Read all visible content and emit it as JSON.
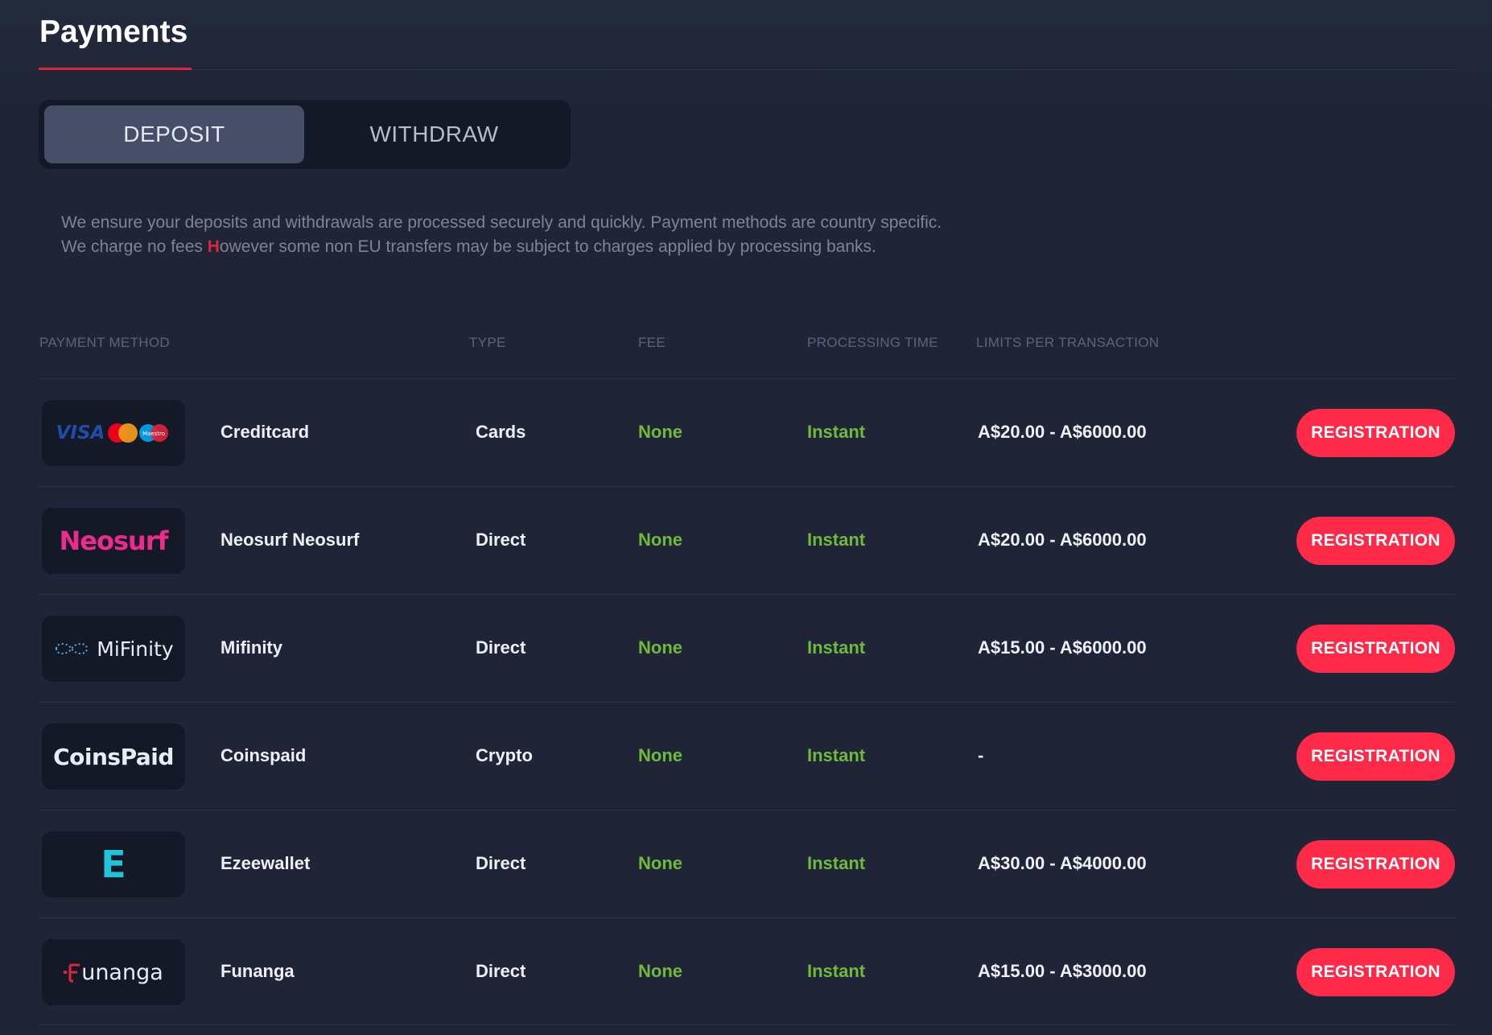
{
  "page": {
    "title": "Payments"
  },
  "tabs": [
    {
      "label": "DEPOSIT",
      "active": true
    },
    {
      "label": "WITHDRAW",
      "active": false
    }
  ],
  "info": {
    "line1": "We ensure your deposits and withdrawals are processed securely and quickly. Payment methods are country specific.",
    "line2_before": "We charge no fees ",
    "line2_highlight": "H",
    "line2_after": "owever  some non EU transfers may be subject to charges applied by processing banks."
  },
  "table": {
    "headers": {
      "method": "PAYMENT METHOD",
      "type": "TYPE",
      "fee": "FEE",
      "time": "PROCESSING TIME",
      "limits": "LIMITS PER TRANSACTION"
    },
    "rows": [
      {
        "name": "Creditcard",
        "type": "Cards",
        "fee": "None",
        "time": "Instant",
        "limits": "A$20.00 - A$6000.00",
        "action": "REGISTRATION",
        "logo": {
          "icon": "visa-mastercard-maestro-logo",
          "text": "VISA",
          "sub": "Maestro"
        }
      },
      {
        "name": "Neosurf Neosurf",
        "type": "Direct",
        "fee": "None",
        "time": "Instant",
        "limits": "A$20.00 - A$6000.00",
        "action": "REGISTRATION",
        "logo": {
          "icon": "neosurf-logo",
          "text": "Neosurf"
        }
      },
      {
        "name": "Mifinity",
        "type": "Direct",
        "fee": "None",
        "time": "Instant",
        "limits": "A$15.00 - A$6000.00",
        "action": "REGISTRATION",
        "logo": {
          "icon": "mifinity-logo",
          "text": "MiFinity"
        }
      },
      {
        "name": "Coinspaid",
        "type": "Crypto",
        "fee": "None",
        "time": "Instant",
        "limits": "-",
        "action": "REGISTRATION",
        "logo": {
          "icon": "coinspaid-logo",
          "text": "CoinsPaid"
        }
      },
      {
        "name": "Ezeewallet",
        "type": "Direct",
        "fee": "None",
        "time": "Instant",
        "limits": "A$30.00 - A$4000.00",
        "action": "REGISTRATION",
        "logo": {
          "icon": "ezeewallet-logo",
          "text": "E"
        }
      },
      {
        "name": "Funanga",
        "type": "Direct",
        "fee": "None",
        "time": "Instant",
        "limits": "A$15.00 - A$3000.00",
        "action": "REGISTRATION",
        "logo": {
          "icon": "funanga-logo",
          "text": "unanga"
        }
      }
    ]
  },
  "colors": {
    "accent": "#fe2a47",
    "green": "#6fba3a",
    "background": "#1f2537",
    "tab_active": "#474f68"
  }
}
